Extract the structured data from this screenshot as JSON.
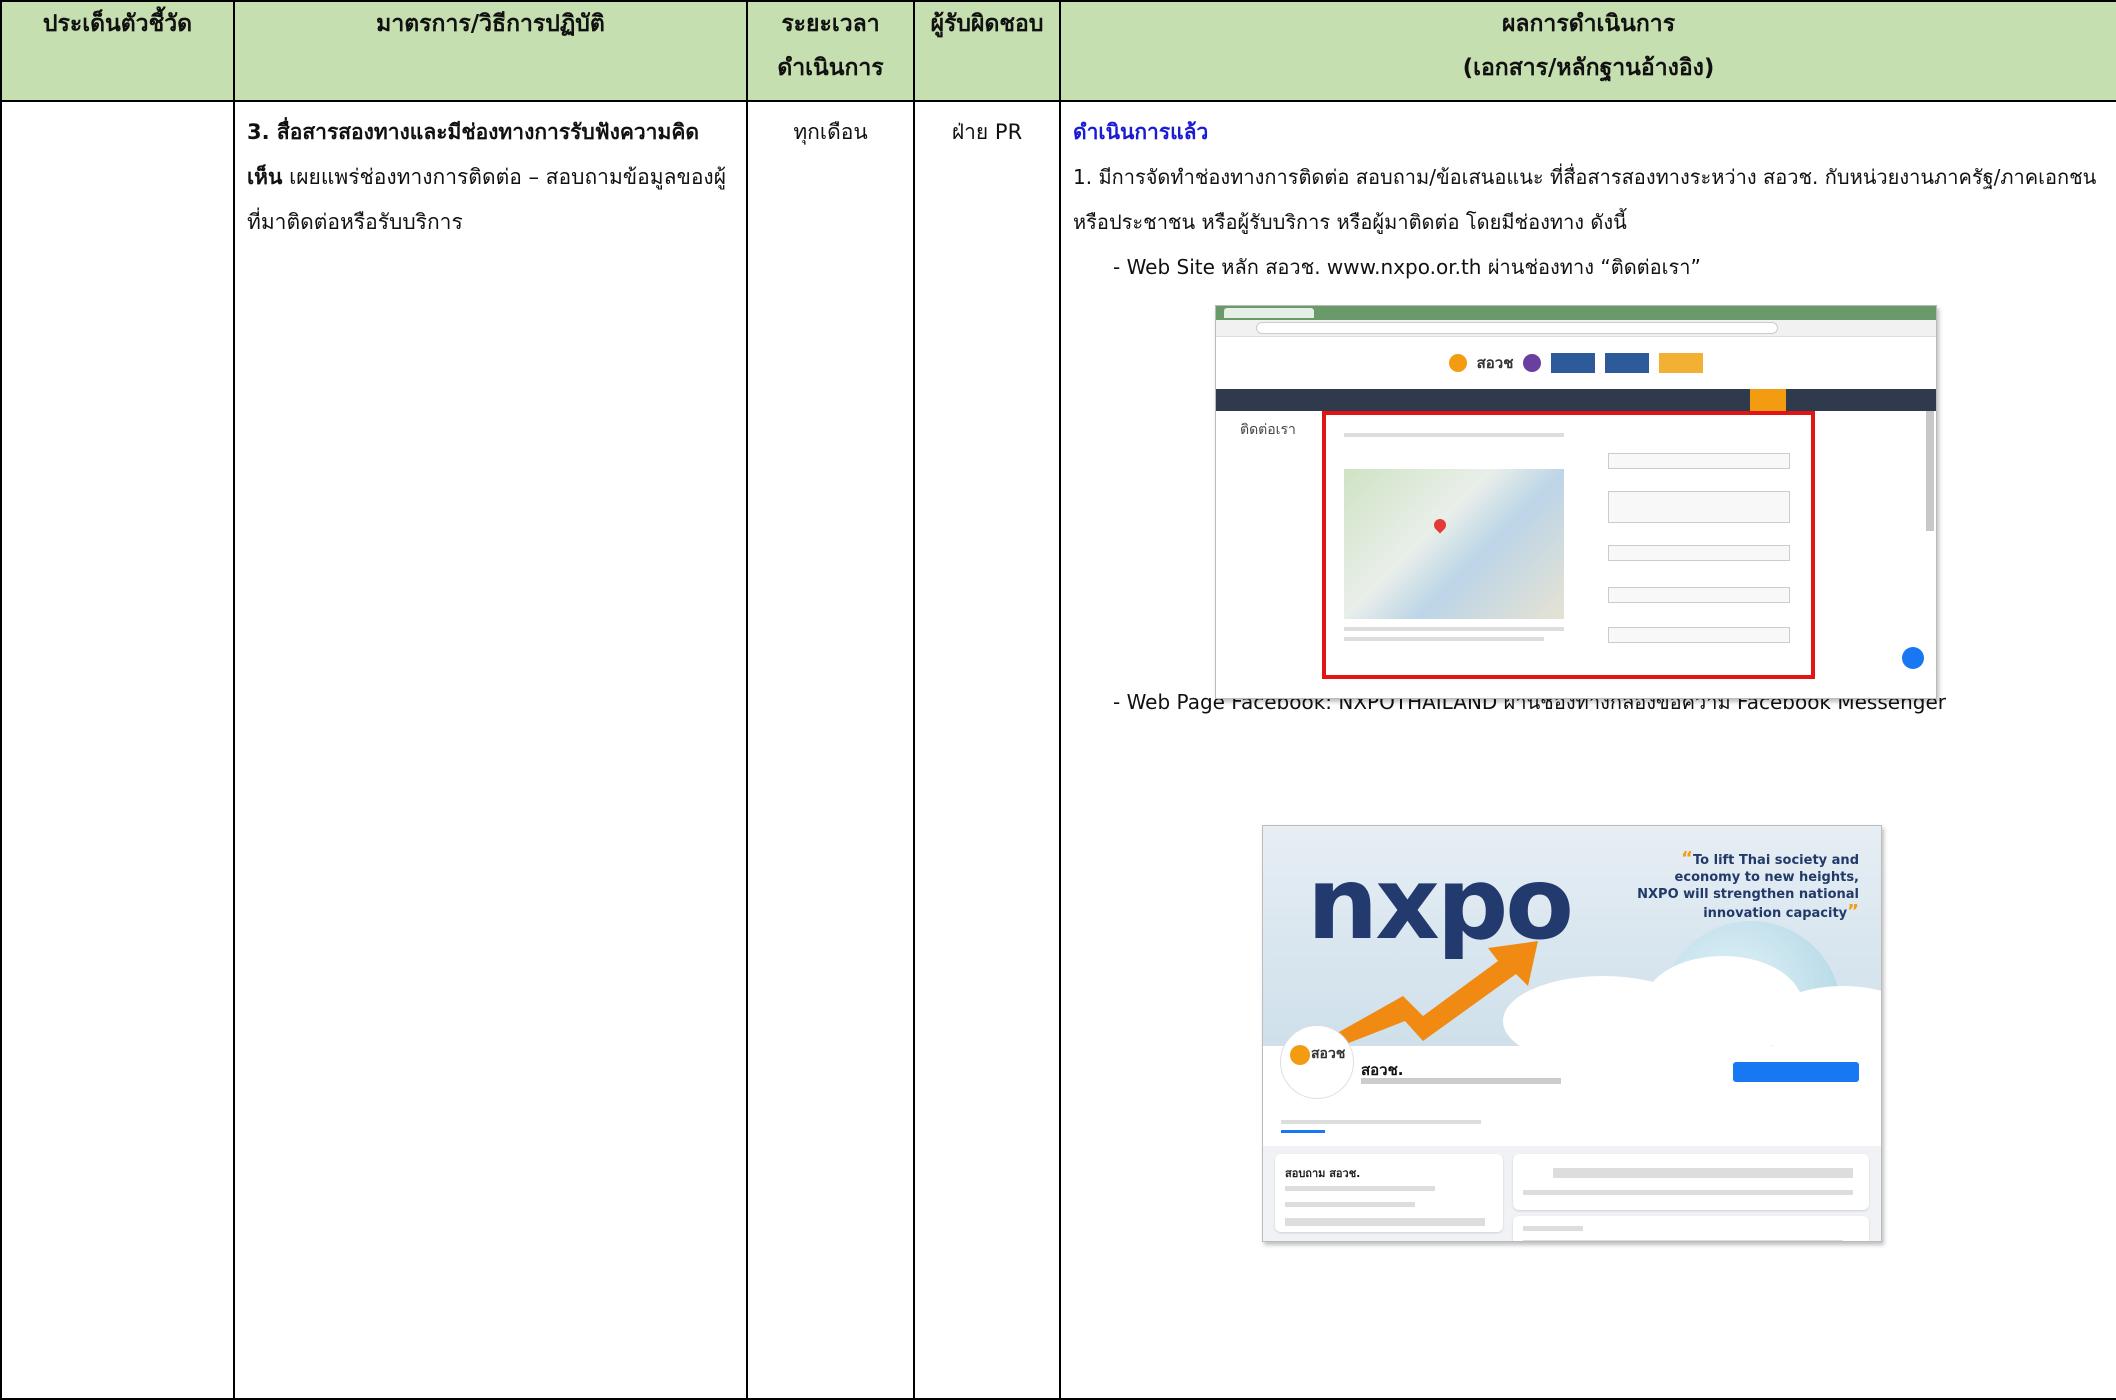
{
  "headers": {
    "col1": "ประเด็นตัวชี้วัด",
    "col2": "มาตรการ/วิธีการปฏิบัติ",
    "col3_line1": "ระยะเวลา",
    "col3_line2": "ดำเนินการ",
    "col4": "ผู้รับผิดชอบ",
    "col5_line1": "ผลการดำเนินการ",
    "col5_line2": "(เอกสาร/หลักฐานอ้างอิง)"
  },
  "row": {
    "indicator": "",
    "measure_bold": "3. สื่อสารสองทางและมีช่องทางการรับฟังความคิดเห็น",
    "measure_text": " เผยแพร่ช่องทางการติดต่อ – สอบถามข้อมูลของผู้ที่มาติดต่อหรือรับบริการ",
    "period": "ทุกเดือน",
    "owner": "ฝ่าย PR",
    "status": "ดำเนินการแล้ว",
    "result_para": "1. มีการจัดทำช่องทางการติดต่อ สอบถาม/ข้อเสนอแนะ ที่สื่อสารสองทางระหว่าง สอวช. กับหน่วยงานภาครัฐ/ภาคเอกชน หรือประชาชน หรือผู้รับบริการ หรือผู้มาติดต่อ โดยมีช่องทาง ดังนี้",
    "bullet1": "- Web Site หลัก สอวช. www.nxpo.or.th ผ่านช่องทาง “ติดต่อเรา”",
    "bullet2": "- Web Page Facebook: NXPOTHAILAND ผ่านช่องทางกล่องข้อความ Facebook Messenger"
  },
  "screenshot_website": {
    "logo_text": "สอวช",
    "page_heading": "ติดต่อเรา"
  },
  "screenshot_facebook": {
    "cover_logo": "nxpo",
    "cover_quote": "To lift Thai society and economy to new heights, NXPO will strengthen national innovation capacity",
    "avatar_text": "สอวช",
    "page_name": "สอวช.",
    "card_title": "สอบถาม สอวช."
  },
  "colors": {
    "header_bg": "#c6dfb0",
    "status_text": "#1b1bd6",
    "highlight_box": "#e21414",
    "nxpo_navy": "#233a6f",
    "nxpo_orange": "#f39c12"
  }
}
